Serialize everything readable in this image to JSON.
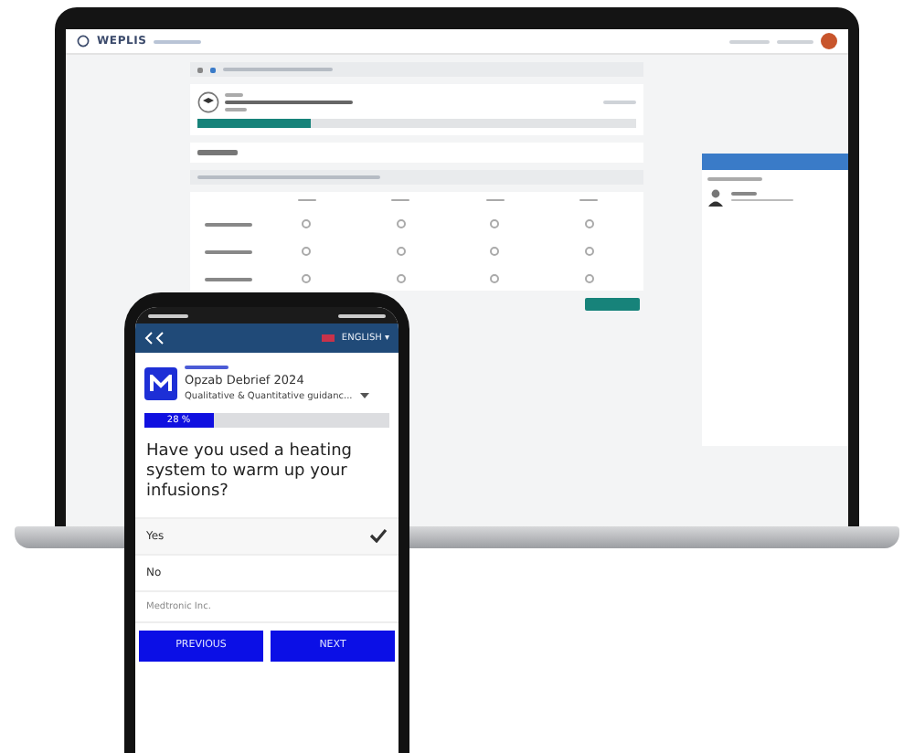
{
  "laptop": {
    "logo": {
      "brand": "WEPLIS"
    },
    "survey": {
      "progress": {
        "level": 0.26
      },
      "table": {
        "rows": [
          {
            "options": [
              {
                "selected": false
              },
              {
                "selected": false
              },
              {
                "selected": false
              },
              {
                "selected": false
              }
            ]
          },
          {
            "options": [
              {
                "selected": false
              },
              {
                "selected": false
              },
              {
                "selected": false
              },
              {
                "selected": false
              }
            ]
          },
          {
            "options": [
              {
                "selected": false
              },
              {
                "selected": false
              },
              {
                "selected": false
              },
              {
                "selected": false
              }
            ]
          }
        ]
      }
    }
  },
  "phone": {
    "language": "ENGLISH ▾",
    "survey_title": "Opzab Debrief 2024",
    "survey_subtitle": "Qualitative & Quantitative guidanc...",
    "progress": {
      "level": 0.28,
      "label": "28 %"
    },
    "question": "Have you used a heating system to warm up your infusions?",
    "answers": [
      {
        "label": "Yes",
        "selected": true
      },
      {
        "label": "No",
        "selected": false
      }
    ],
    "other": {
      "placeholder": "Medtronic Inc."
    },
    "buttons": [
      {
        "label": "PREVIOUS"
      },
      {
        "label": "NEXT"
      }
    ]
  }
}
